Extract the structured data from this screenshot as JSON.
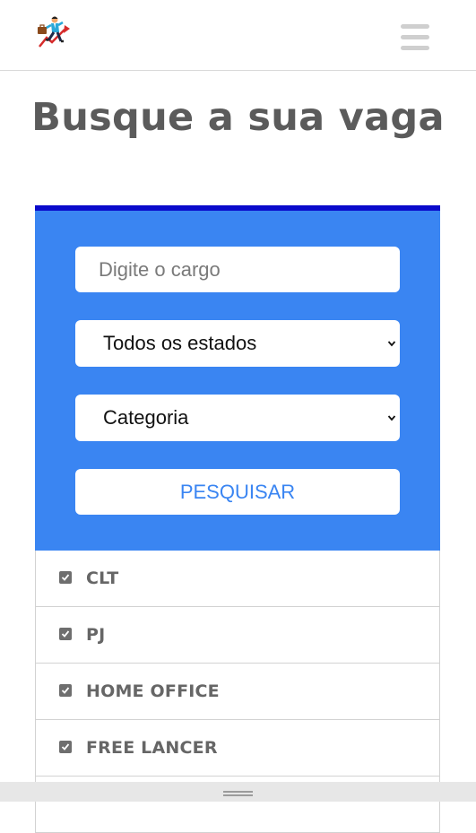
{
  "header": {
    "logo_icon": "running-businessman-chart-icon",
    "menu_icon": "hamburger-menu-icon"
  },
  "page": {
    "title": "Busque a sua vaga"
  },
  "search": {
    "cargo_placeholder": "Digite o cargo",
    "estado_selected": "Todos os estados",
    "categoria_selected": "Categoria",
    "button_label": "PESQUISAR"
  },
  "filters": [
    {
      "label": "CLT",
      "checked": true
    },
    {
      "label": "PJ",
      "checked": true
    },
    {
      "label": "HOME OFFICE",
      "checked": true
    },
    {
      "label": "FREE LANCER",
      "checked": true
    }
  ],
  "colors": {
    "panel_blue": "#3a85f2",
    "panel_border": "#0a0acb",
    "title_gray": "#5b5b5b",
    "label_gray": "#666666"
  }
}
